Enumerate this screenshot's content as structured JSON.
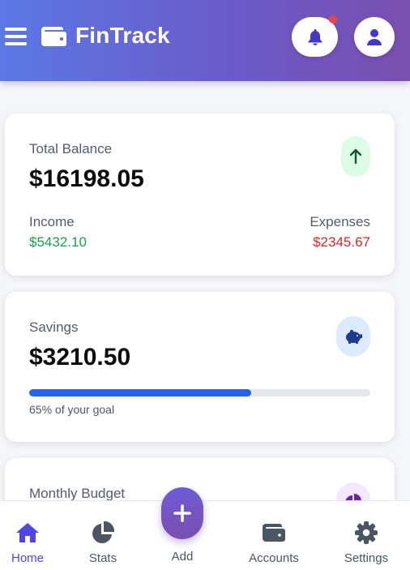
{
  "app": {
    "title": "FinTrack"
  },
  "icons": {
    "menu": "menu-icon",
    "logo": "wallet-icon",
    "notifications": "bell-icon",
    "profile": "user-icon",
    "trend": "arrow-up-icon",
    "savings": "piggy-bank-icon",
    "budget": "pie-chart-icon",
    "add": "plus-icon"
  },
  "colors": {
    "header_start": "#5b78e6",
    "header_end": "#7a4fb0",
    "income": "#16a34a",
    "expenses": "#dc2626",
    "progress": "#2563eb",
    "active_nav": "#4f46e5",
    "notification_dot": "#ef4444"
  },
  "balance_card": {
    "label": "Total Balance",
    "amount": "$16198.05",
    "income_label": "Income",
    "income_value": "$5432.10",
    "expenses_label": "Expenses",
    "expenses_value": "$2345.67"
  },
  "savings_card": {
    "label": "Savings",
    "amount": "$3210.50",
    "progress_percent": 65,
    "progress_text": "65% of your goal"
  },
  "budget_card": {
    "label": "Monthly Budget"
  },
  "nav": {
    "items": [
      {
        "label": "Home",
        "icon": "home-icon",
        "active": true
      },
      {
        "label": "Stats",
        "icon": "pie-chart-icon",
        "active": false
      },
      {
        "label": "Add",
        "icon": "plus-icon",
        "active": false
      },
      {
        "label": "Accounts",
        "icon": "wallet-icon",
        "active": false
      },
      {
        "label": "Settings",
        "icon": "gear-icon",
        "active": false
      }
    ]
  }
}
